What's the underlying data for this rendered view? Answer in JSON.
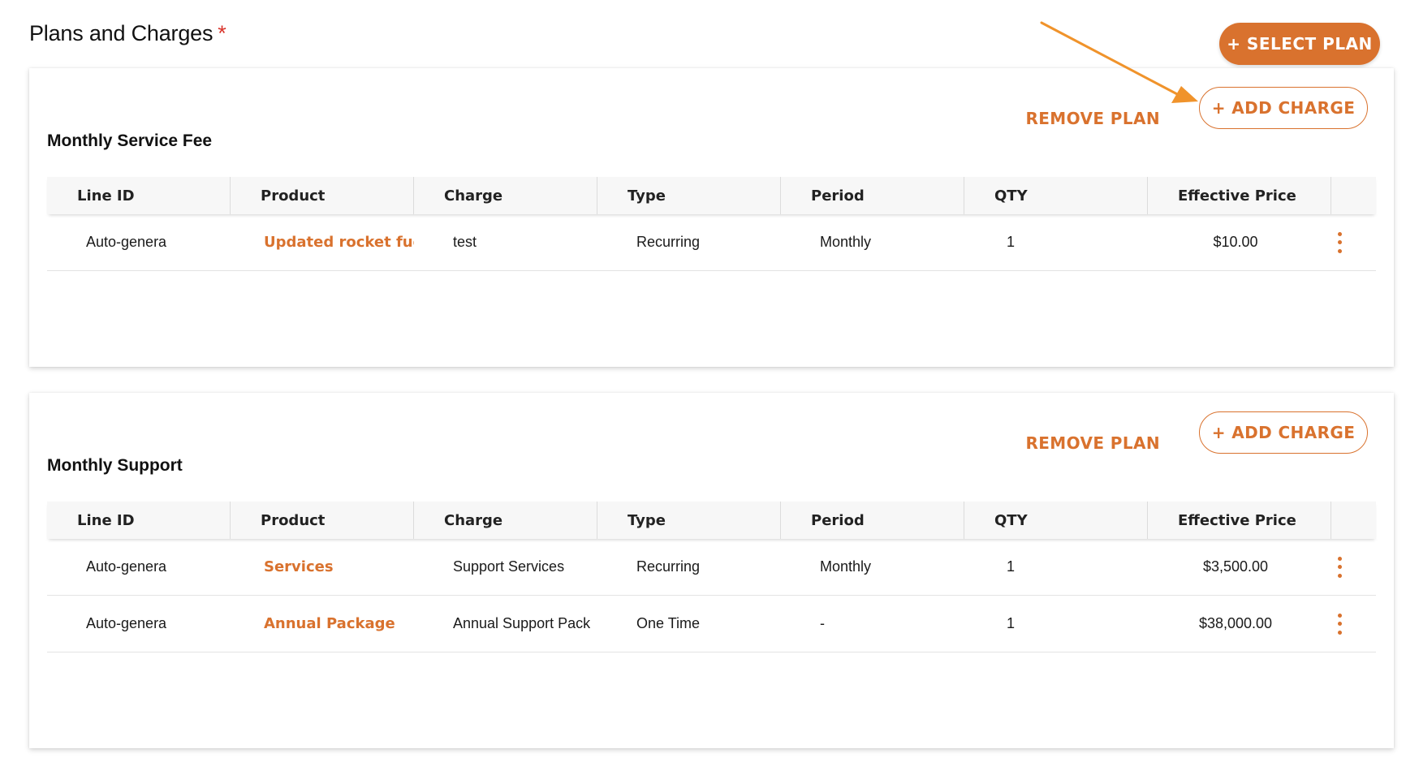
{
  "section": {
    "title": "Plans and Charges",
    "required_marker": "*"
  },
  "select_plan_label": "+ SELECT PLAN",
  "colors": {
    "accent": "#d9722e",
    "required": "#d9342b"
  },
  "columns": [
    "Line ID",
    "Product",
    "Charge",
    "Type",
    "Period",
    "QTY",
    "Effective Price"
  ],
  "plans": [
    {
      "name": "Monthly Service Fee",
      "remove_label": "REMOVE PLAN",
      "add_charge_label": "+ ADD CHARGE",
      "rows": [
        {
          "line_id": "Auto-genera",
          "product": "Updated rocket fue",
          "charge": "test",
          "type": "Recurring",
          "period": "Monthly",
          "qty": "1",
          "price": "$10.00"
        }
      ]
    },
    {
      "name": "Monthly Support",
      "remove_label": "REMOVE PLAN",
      "add_charge_label": "+ ADD CHARGE",
      "rows": [
        {
          "line_id": "Auto-genera",
          "product": "Services",
          "charge": "Support Services",
          "type": "Recurring",
          "period": "Monthly",
          "qty": "1",
          "price": "$3,500.00"
        },
        {
          "line_id": "Auto-genera",
          "product": "Annual Package",
          "charge": "Annual Support Pack",
          "type": "One Time",
          "period": "-",
          "qty": "1",
          "price": "$38,000.00"
        }
      ]
    }
  ],
  "icons": {
    "row_menu": "more-vertical-icon",
    "annotation": "arrow-annotation"
  }
}
